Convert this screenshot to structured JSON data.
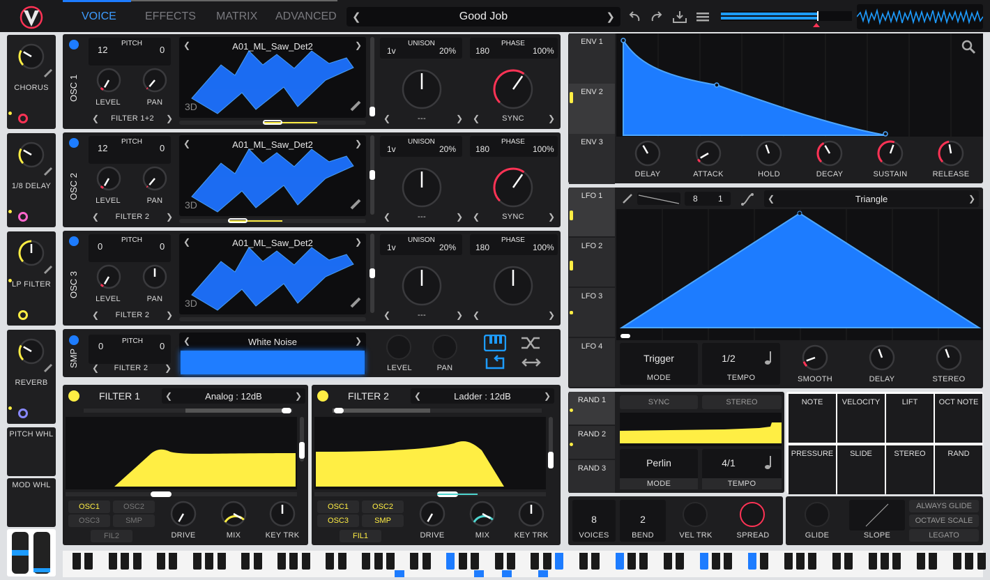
{
  "tabs": [
    "VOICE",
    "EFFECTS",
    "MATRIX",
    "ADVANCED"
  ],
  "preset": {
    "name": "Good Job"
  },
  "fx": [
    {
      "label": "CHORUS",
      "dot": "#ffee44",
      "ring": "#ff3355"
    },
    {
      "label": "1/8 DELAY",
      "dot": "#ffee44",
      "ring": "#ff66cc"
    },
    {
      "label": "LP FILTER",
      "dot": "#ffee44",
      "ring": "#ffee44"
    },
    {
      "label": "REVERB",
      "dot": "#ffee44",
      "ring": "#8888ff"
    }
  ],
  "side": {
    "pitch": "PITCH WHL",
    "mod": "MOD WHL"
  },
  "osc": [
    {
      "label": "OSC 1",
      "pitch": "12",
      "pitch_fine": "0",
      "wave": "A01_ML_Saw_Det2",
      "uni_voices": "1v",
      "uni_pct": "20%",
      "phase": "180",
      "phase_pct": "100%",
      "filter": "FILTER 1+2",
      "uni_sel": "---",
      "sync": "SYNC"
    },
    {
      "label": "OSC 2",
      "pitch": "12",
      "pitch_fine": "0",
      "wave": "A01_ML_Saw_Det2",
      "uni_voices": "1v",
      "uni_pct": "20%",
      "phase": "180",
      "phase_pct": "100%",
      "filter": "FILTER 2",
      "uni_sel": "---",
      "sync": "SYNC"
    },
    {
      "label": "OSC 3",
      "pitch": "0",
      "pitch_fine": "0",
      "wave": "A01_ML_Saw_Det2",
      "uni_voices": "1v",
      "uni_pct": "20%",
      "phase": "180",
      "phase_pct": "100%",
      "filter": "FILTER 2",
      "uni_sel": "---",
      "sync": ""
    }
  ],
  "common": {
    "pitch": "PITCH",
    "level": "LEVEL",
    "pan": "PAN",
    "unison": "UNISON",
    "phase": "PHASE",
    "d3": "3D"
  },
  "smp": {
    "label": "SMP",
    "pitch": "0",
    "pitch_fine": "0",
    "name": "White Noise",
    "filter": "FILTER 2"
  },
  "filters": [
    {
      "label": "FILTER 1",
      "type": "Analog : 12dB",
      "sources": [
        "OSC1",
        "OSC2",
        "OSC3",
        "SMP",
        "FIL2"
      ],
      "drive": "DRIVE",
      "mix": "MIX",
      "keytrk": "KEY TRK"
    },
    {
      "label": "FILTER 2",
      "type": "Ladder : 12dB",
      "sources": [
        "OSC1",
        "OSC2",
        "OSC3",
        "SMP",
        "FIL1"
      ],
      "drive": "DRIVE",
      "mix": "MIX",
      "keytrk": "KEY TRK"
    }
  ],
  "env": {
    "tabs": [
      "ENV 1",
      "ENV 2",
      "ENV 3"
    ],
    "knobs": [
      "DELAY",
      "ATTACK",
      "HOLD",
      "DECAY",
      "SUSTAIN",
      "RELEASE"
    ]
  },
  "lfo": {
    "tabs": [
      "LFO 1",
      "LFO 2",
      "LFO 3",
      "LFO 4"
    ],
    "num": "8",
    "den": "1",
    "shape": "Triangle",
    "mode_val": "Trigger",
    "mode": "MODE",
    "tempo_val": "1/2",
    "tempo": "TEMPO",
    "knobs": [
      "SMOOTH",
      "DELAY",
      "STEREO"
    ]
  },
  "rand": {
    "tabs": [
      "RAND 1",
      "RAND 2",
      "RAND 3"
    ],
    "sync": "SYNC",
    "stereo": "STEREO",
    "mode_val": "Perlin",
    "mode": "MODE",
    "tempo_val": "4/1",
    "tempo": "TEMPO"
  },
  "sources": [
    "NOTE",
    "VELOCITY",
    "LIFT",
    "OCT NOTE",
    "PRESSURE",
    "SLIDE",
    "STEREO",
    "RAND"
  ],
  "voice": {
    "voices_val": "8",
    "voices": "VOICES",
    "bend_val": "2",
    "bend": "BEND",
    "veltrk": "VEL TRK",
    "spread": "SPREAD"
  },
  "glide": {
    "glide": "GLIDE",
    "slope": "SLOPE",
    "always": "ALWAYS GLIDE",
    "octave": "OCTAVE SCALE",
    "legato": "LEGATO"
  }
}
